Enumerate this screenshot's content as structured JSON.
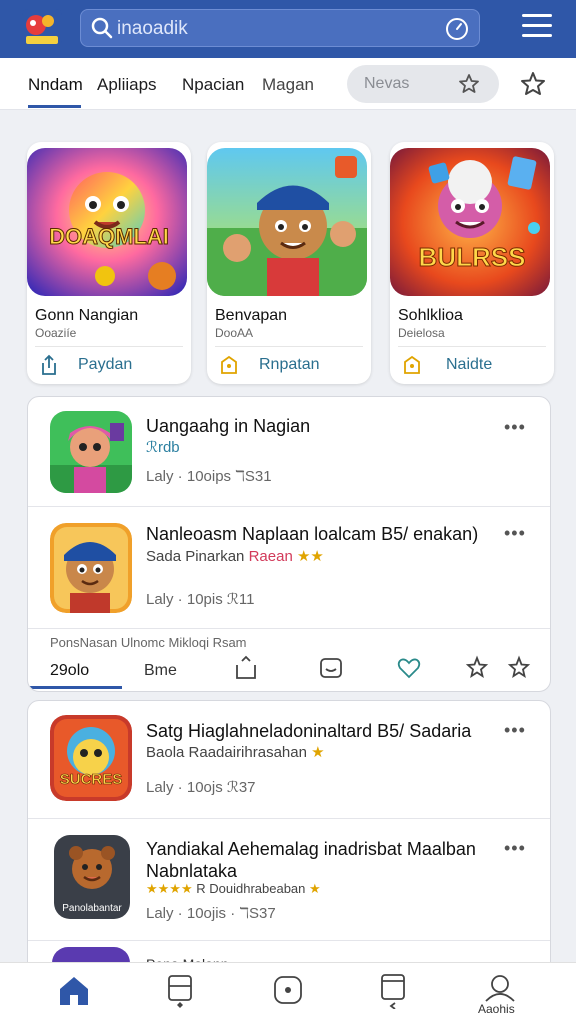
{
  "header": {
    "search_text": "inaoadik"
  },
  "tabs": [
    {
      "label": "Nndam"
    },
    {
      "label": "Apliiaps"
    },
    {
      "label": "Npacian"
    },
    {
      "label": "Magan"
    }
  ],
  "filter_pill": {
    "label": "Nevas"
  },
  "featured": [
    {
      "art_text": "DOAQMLAI",
      "title": "Gonn Nangian",
      "subtitle": "Ooaziíe",
      "action": "Paydan"
    },
    {
      "art_text": "",
      "title": "Benvapan",
      "subtitle": "DooAA",
      "action": "Rnpatan"
    },
    {
      "art_text": "BULRSS",
      "title": "Sohlklioa",
      "subtitle": "Deielosa",
      "action": "Naidte"
    }
  ],
  "panel1": {
    "items": [
      {
        "title": "Uangaahg in Nagian",
        "subtitle": "ℛrdb",
        "meta": "Laly · 10oips  ℸS31",
        "more": "•••"
      },
      {
        "title": "Nanleoasm Naplaan loalcam B5/ enakan)",
        "subtitle": "Sada Pinarkan",
        "subtitle_accent": "Raean",
        "meta": "Laly · 10pis  ℛ11",
        "more": "•••"
      }
    ],
    "notice": "PonsNasan Ulnomc Mikloqi Rsam",
    "tabs": [
      {
        "label": "29olo"
      },
      {
        "label": "Bme"
      }
    ]
  },
  "panel2": {
    "items": [
      {
        "art_text": "SUCRES",
        "title": "Satg Hiaglahneladoninaltard B5/ Sadaria",
        "subtitle": "Baola Raadairihrasahan",
        "meta": "Laly · 10ojs  ℛ37",
        "more": "•••"
      },
      {
        "art_text": "Panolabantar",
        "title": "Yandiakal Aehemalag inadrisbat Maalban",
        "title2": "Nabnlataka",
        "subtitle": "R Douidhrabeaban",
        "meta": "Laly · 10ojis · ℸS37",
        "more": "•••"
      },
      {
        "title": "Pona Malann"
      }
    ]
  },
  "bottom_nav": {
    "profile_label": "Aaohis"
  }
}
